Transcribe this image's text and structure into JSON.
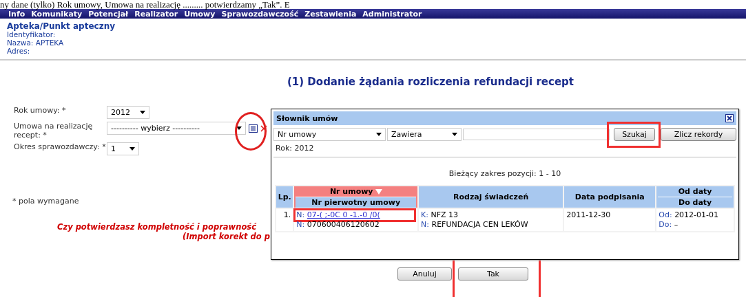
{
  "document_line": "ny dane (tylko) Rok umowy, Umowa na realizację ......... potwierdzamy „Tak”. E",
  "menu": [
    {
      "label": "Info"
    },
    {
      "label": "Komunikaty"
    },
    {
      "label": "Potencjał"
    },
    {
      "label": "Realizator"
    },
    {
      "label": "Umowy"
    },
    {
      "label": "Sprawozdawczość"
    },
    {
      "label": "Zestawienia"
    },
    {
      "label": "Administrator"
    }
  ],
  "header": {
    "title": "Apteka/Punkt apteczny",
    "fields": [
      {
        "label": "Identyfikator:"
      },
      {
        "label": "Nazwa:",
        "value": "APTEKA"
      },
      {
        "label": "Adres:"
      }
    ]
  },
  "page_title": "(1) Dodanie żądania rozliczenia refundacji recept",
  "form": {
    "fields": [
      {
        "kind": "select",
        "label": "Rok umowy: *",
        "value": "2012"
      },
      {
        "kind": "lookup",
        "label": "Umowa na realizację recept: *",
        "value": "---------- wybierz ----------"
      },
      {
        "kind": "select",
        "label": "Okres sprawozdawczy: *",
        "value": "1"
      }
    ],
    "required_note": "* pola wymagane"
  },
  "confirmation": [
    "Czy potwierdzasz kompletność i poprawność",
    "(Import korekt do p"
  ],
  "buttons": [
    {
      "label": "Anuluj",
      "highlighted": false
    },
    {
      "label": "Tak",
      "highlighted": true
    }
  ],
  "dialog": {
    "title": "Słownik umów",
    "filter": {
      "field": "Nr umowy",
      "operator": "Zawiera",
      "buttons": [
        {
          "label": "Szukaj",
          "highlighted": true
        },
        {
          "label": "Zlicz rekordy",
          "highlighted": false
        }
      ]
    },
    "year": "Rok: 2012",
    "range": "Bieżący zakres pozycji: 1 - 10",
    "table": {
      "columns": [
        {
          "label": "Lp.",
          "sorted": false
        },
        {
          "label": "Nr umowy",
          "sublabel": "Nr pierwotny umowy",
          "sorted": true
        },
        {
          "label": "Rodzaj świadczeń",
          "sorted": false
        },
        {
          "label": "Data podpisania",
          "sorted": false
        },
        {
          "label": "Od daty",
          "sublabel": "Do daty",
          "sorted": false
        }
      ],
      "rows": [
        {
          "cells": [
            [
              {
                "text": "1."
              }
            ],
            [
              {
                "prefix": "N:",
                "text": "07-( ;-0C  0 -1.-0 /0(",
                "link": true,
                "highlighted": true
              },
              {
                "prefix": "N:",
                "text": "070600406120602"
              }
            ],
            [
              {
                "prefix": "K:",
                "text": "NFZ 13"
              },
              {
                "prefix": "N:",
                "text": "REFUNDACJA CEN LEKÓW"
              }
            ],
            [
              {
                "text": "2011-12-30"
              }
            ],
            [
              {
                "prefix": "Od:",
                "text": "2012-01-01"
              },
              {
                "prefix": "Do:",
                "text": "–"
              }
            ]
          ]
        }
      ]
    }
  }
}
